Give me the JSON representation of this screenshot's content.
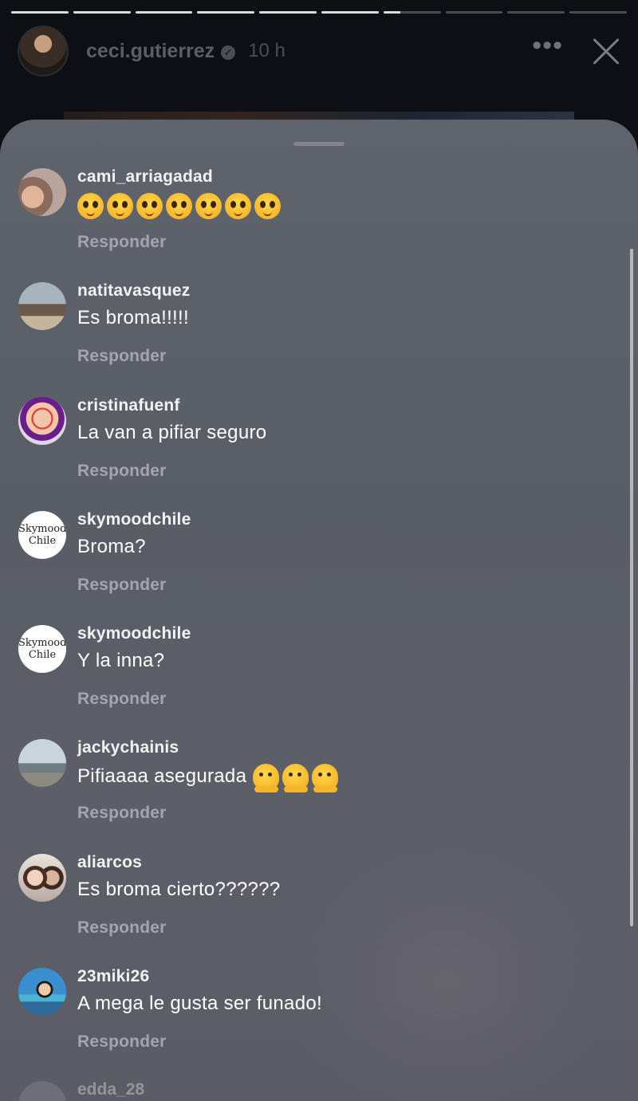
{
  "story": {
    "username": "ceci.gutierrez",
    "time": "10 h",
    "segments": [
      1,
      1,
      1,
      1,
      1,
      1,
      0.3,
      0,
      0,
      0
    ]
  },
  "comments": [
    {
      "username": "cami_arriagadad",
      "text": "",
      "emoji": "pleading",
      "emoji_count": 7,
      "reply": "Responder"
    },
    {
      "username": "natitavasquez",
      "text": "Es broma!!!!!",
      "reply": "Responder"
    },
    {
      "username": "cristinafuenf",
      "text": "La van a pifiar seguro",
      "reply": "Responder"
    },
    {
      "username": "skymoodchile",
      "text": "Broma?",
      "reply": "Responder",
      "avatar_text": "Skymood\nChile"
    },
    {
      "username": "skymoodchile",
      "text": "Y la inna?",
      "reply": "Responder",
      "avatar_text": "Skymood\nChile"
    },
    {
      "username": "jackychainis",
      "text": "Pifiaaaa asegurada",
      "emoji": "melting-face",
      "emoji_count": 3,
      "reply": "Responder"
    },
    {
      "username": "aliarcos",
      "text": "Es broma cierto??????",
      "reply": "Responder"
    },
    {
      "username": "23miki26",
      "text": "A mega le gusta ser funado!",
      "reply": "Responder"
    }
  ],
  "partial_comment": {
    "username": "edda_28"
  }
}
